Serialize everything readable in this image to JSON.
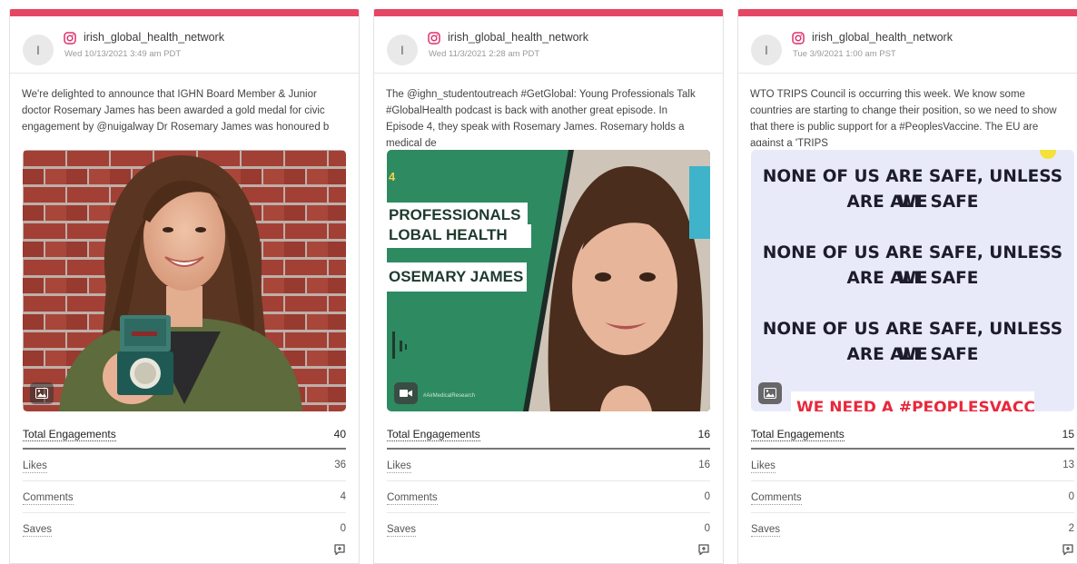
{
  "cards": [
    {
      "avatar_initial": "I",
      "account": "irish_global_health_network",
      "timestamp": "Wed 10/13/2021 3:49 am PDT",
      "caption": "We're delighted to announce that IGHN Board Member & Junior doctor Rosemary James has been awarded a gold medal for civic engagement by @nuigalway Dr Rosemary James was honoured b",
      "media_type_icon": "image-icon",
      "metrics": [
        {
          "label": "Total Engagements",
          "value": "40"
        },
        {
          "label": "Likes",
          "value": "36"
        },
        {
          "label": "Comments",
          "value": "4"
        },
        {
          "label": "Saves",
          "value": "0"
        }
      ]
    },
    {
      "avatar_initial": "I",
      "account": "irish_global_health_network",
      "timestamp": "Wed 11/3/2021 2:28 am PDT",
      "caption": "The @ighn_studentoutreach #GetGlobal: Young Professionals Talk #GlobalHealth podcast is back with another great episode. In Episode 4, they speak with Rosemary James. Rosemary holds a medical de",
      "media_type_icon": "video-icon",
      "media_text": {
        "number": "4",
        "line1": "PROFESSIONALS",
        "line2": "LOBAL HEALTH",
        "line3": "OSEMARY JAMES",
        "footer": "#AirMedicalResearch"
      },
      "metrics": [
        {
          "label": "Total Engagements",
          "value": "16"
        },
        {
          "label": "Likes",
          "value": "16"
        },
        {
          "label": "Comments",
          "value": "0"
        },
        {
          "label": "Saves",
          "value": "0"
        }
      ]
    },
    {
      "avatar_initial": "I",
      "account": "irish_global_health_network",
      "timestamp": "Tue 3/9/2021 1:00 am PST",
      "caption": "WTO TRIPS Council is occurring this week. We know some countries are starting to change their position, so we need to show that there is public support for a #PeoplesVaccine. The EU are against a 'TRIPS",
      "media_type_icon": "image-icon",
      "media_text": {
        "block1_line1": "NONE OF US ARE SAFE, UNLESS WE",
        "block1_line2": "ARE ALL SAFE",
        "block2_line1": "NONE OF US ARE SAFE, UNLESS WE",
        "block2_line2": "ARE ALL SAFE",
        "block3_line1": "NONE OF US ARE SAFE, UNLESS WE",
        "block3_line2": "ARE ALL SAFE",
        "banner": "WE NEED A #PEOPLESVACCINE"
      },
      "metrics": [
        {
          "label": "Total Engagements",
          "value": "15"
        },
        {
          "label": "Likes",
          "value": "13"
        },
        {
          "label": "Comments",
          "value": "0"
        },
        {
          "label": "Saves",
          "value": "2"
        }
      ]
    }
  ],
  "colors": {
    "accent_bar": "#e54663",
    "instagram_icon": "#e1306c",
    "card3_background": "#e9eaf9",
    "card2_green": "#2e8a60",
    "card3_banner_red": "#e8283b"
  }
}
